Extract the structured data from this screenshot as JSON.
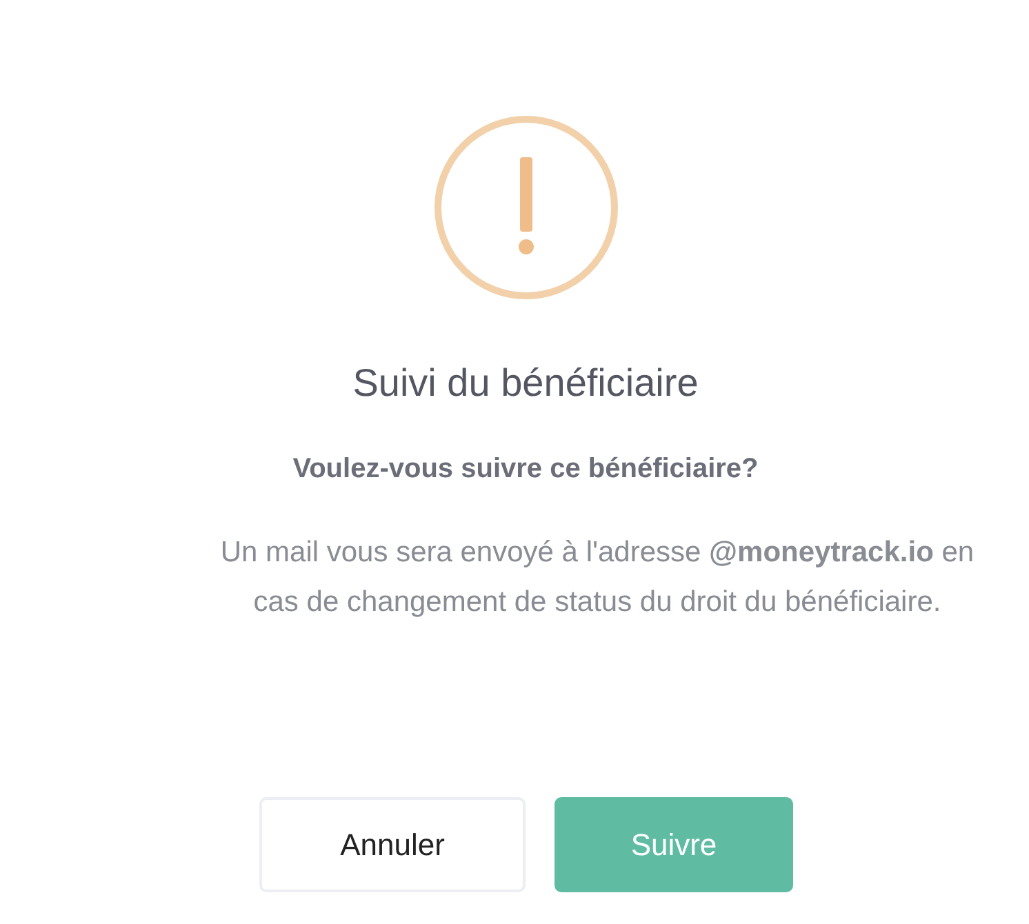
{
  "title": "Suivi du bénéficiaire",
  "question": "Voulez-vous suivre ce bénéficiaire?",
  "message": "Un mail vous sera envoyé à l'adresse **@moneytrack.io** en cas de changement de status du droit du bénéficiaire.",
  "buttons": [
    {
      "label": "Annuler",
      "kind": "secondary"
    },
    {
      "label": "Suivre",
      "kind": "primary"
    }
  ]
}
